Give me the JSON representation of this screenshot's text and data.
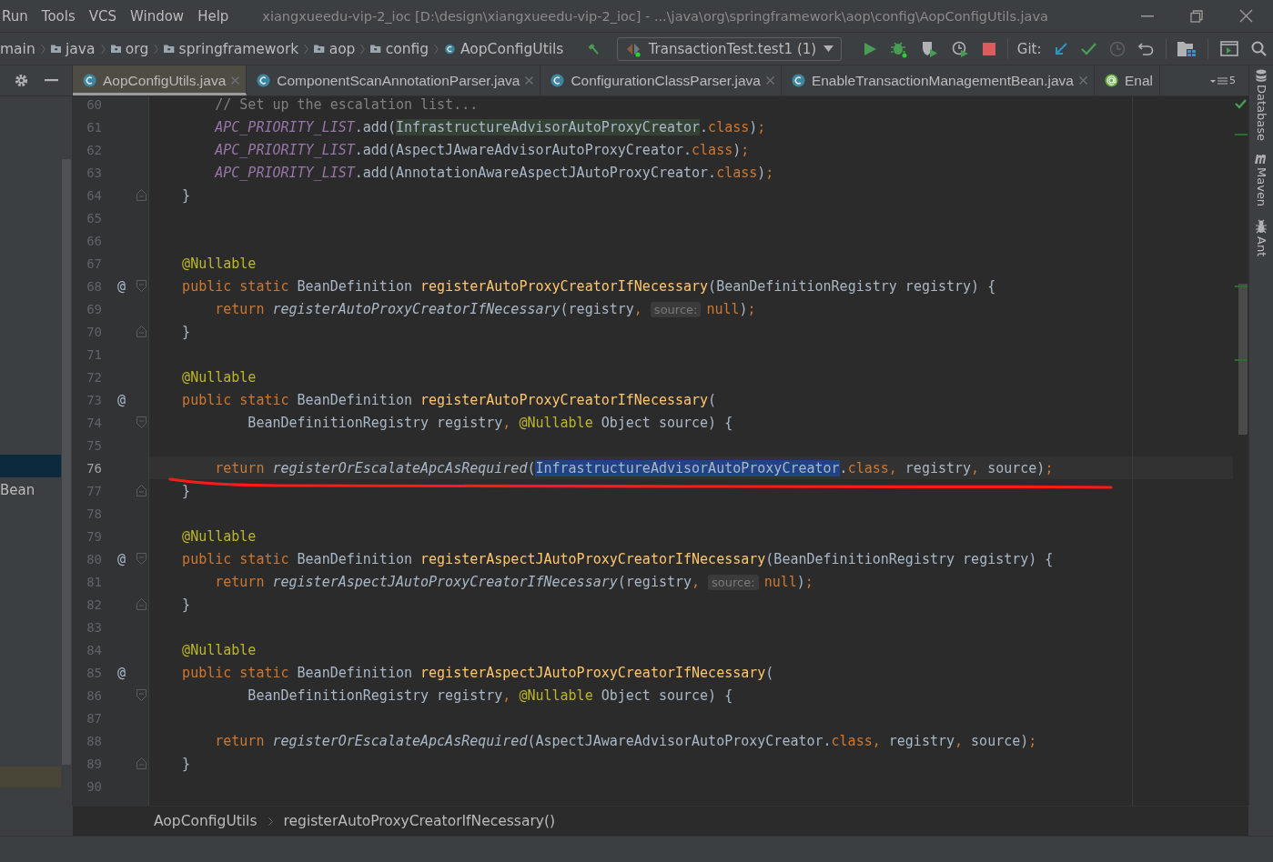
{
  "menu": [
    {
      "label": "Run"
    },
    {
      "label": "Tools"
    },
    {
      "label": "VCS"
    },
    {
      "label": "Window"
    },
    {
      "label": "Help"
    }
  ],
  "window": {
    "title": "xiangxueedu-vip-2_ioc [D:\\design\\xiangxueedu-vip-2_ioc] - ...\\java\\org\\springframework\\aop\\config\\AopConfigUtils.java"
  },
  "navigation": [
    {
      "label": "main",
      "kind": "text"
    },
    {
      "label": "java",
      "kind": "folder"
    },
    {
      "label": "org",
      "kind": "folder"
    },
    {
      "label": "springframework",
      "kind": "folder"
    },
    {
      "label": "aop",
      "kind": "folder"
    },
    {
      "label": "config",
      "kind": "folder"
    },
    {
      "label": "AopConfigUtils",
      "kind": "class"
    }
  ],
  "run_config": {
    "label": "TransactionTest.test1 (1)"
  },
  "git_label": "Git:",
  "tabs": [
    {
      "label": "AopConfigUtils.java",
      "kind": "class",
      "selected": true,
      "closable": true
    },
    {
      "label": "ComponentScanAnnotationParser.java",
      "kind": "class",
      "selected": false,
      "closable": true
    },
    {
      "label": "ConfigurationClassParser.java",
      "kind": "class",
      "selected": false,
      "closable": true
    },
    {
      "label": "EnableTransactionManagementBean.java",
      "kind": "class",
      "selected": false,
      "closable": true
    },
    {
      "label": "Enal",
      "kind": "annotation",
      "selected": false,
      "closable": false
    }
  ],
  "tab_count": "5",
  "project_panel": {
    "items": [
      {
        "label": "Bean"
      }
    ]
  },
  "tool_windows": [
    {
      "label": "Database",
      "kind": "database"
    },
    {
      "label": "Maven",
      "kind": "maven"
    },
    {
      "label": "Ant",
      "kind": "ant"
    }
  ],
  "code": {
    "lines": [
      {
        "number": "60",
        "current": false,
        "tokens": [
          {
            "text": "        // Set up the escalation list...",
            "kind": "comment"
          }
        ]
      },
      {
        "number": "61",
        "current": false,
        "tokens": [
          {
            "text": "        APC_PRIORITY_LIST",
            "kind": "constant"
          },
          {
            "text": ".add(",
            "kind": "plain"
          },
          {
            "text": "InfrastructureAdvisorAutoProxyCreator",
            "kind": "usage"
          },
          {
            "text": ".",
            "kind": "plain"
          },
          {
            "text": "class",
            "kind": "keyword"
          },
          {
            "text": ")",
            "kind": "plain"
          },
          {
            "text": ";",
            "kind": "keyword"
          }
        ]
      },
      {
        "number": "62",
        "current": false,
        "tokens": [
          {
            "text": "        APC_PRIORITY_LIST",
            "kind": "constant"
          },
          {
            "text": ".add(AspectJAwareAdvisorAutoProxyCreator.",
            "kind": "plain"
          },
          {
            "text": "class",
            "kind": "keyword"
          },
          {
            "text": ")",
            "kind": "plain"
          },
          {
            "text": ";",
            "kind": "keyword"
          }
        ]
      },
      {
        "number": "63",
        "current": false,
        "tokens": [
          {
            "text": "        APC_PRIORITY_LIST",
            "kind": "constant"
          },
          {
            "text": ".add(AnnotationAwareAspectJAutoProxyCreator.",
            "kind": "plain"
          },
          {
            "text": "class",
            "kind": "keyword"
          },
          {
            "text": ")",
            "kind": "plain"
          },
          {
            "text": ";",
            "kind": "keyword"
          }
        ]
      },
      {
        "number": "64",
        "current": false,
        "fold": {
          "kind": "end"
        },
        "tokens": [
          {
            "text": "    }",
            "kind": "plain"
          }
        ]
      },
      {
        "number": "65",
        "current": false
      },
      {
        "number": "66",
        "current": false
      },
      {
        "number": "67",
        "current": false,
        "tokens": [
          {
            "text": "    @Nullable",
            "kind": "annotation"
          }
        ]
      },
      {
        "number": "68",
        "current": false,
        "marker": "@",
        "fold": {
          "kind": "start"
        },
        "tokens": [
          {
            "text": "    public static",
            "kind": "keyword"
          },
          {
            "text": " BeanDefinition ",
            "kind": "plain"
          },
          {
            "text": "registerAutoProxyCreatorIfNecessary",
            "kind": "declaration"
          },
          {
            "text": "(BeanDefinitionRegistry registry) {",
            "kind": "plain"
          }
        ]
      },
      {
        "number": "69",
        "current": false,
        "tokens": [
          {
            "text": "        return",
            "kind": "keyword"
          },
          {
            "text": " registerAutoProxyCreatorIfNecessary",
            "kind": "call"
          },
          {
            "text": "(registry",
            "kind": "plain"
          },
          {
            "text": ",",
            "kind": "keyword"
          },
          {
            "text": "source:",
            "kind": "hint"
          },
          {
            "text": "null",
            "kind": "keyword"
          },
          {
            "text": ")",
            "kind": "plain"
          },
          {
            "text": ";",
            "kind": "keyword"
          }
        ]
      },
      {
        "number": "70",
        "current": false,
        "fold": {
          "kind": "end"
        },
        "tokens": [
          {
            "text": "    }",
            "kind": "plain"
          }
        ]
      },
      {
        "number": "71",
        "current": false
      },
      {
        "number": "72",
        "current": false,
        "tokens": [
          {
            "text": "    @Nullable",
            "kind": "annotation"
          }
        ]
      },
      {
        "number": "73",
        "current": false,
        "marker": "@",
        "tokens": [
          {
            "text": "    public static",
            "kind": "keyword"
          },
          {
            "text": " BeanDefinition ",
            "kind": "plain"
          },
          {
            "text": "registerAutoProxyCreatorIfNecessary",
            "kind": "declaration"
          },
          {
            "text": "(",
            "kind": "plain"
          }
        ]
      },
      {
        "number": "74",
        "current": false,
        "fold": {
          "kind": "start"
        },
        "tokens": [
          {
            "text": "            BeanDefinitionRegistry registry",
            "kind": "plain"
          },
          {
            "text": ", ",
            "kind": "keyword"
          },
          {
            "text": "@Nullable",
            "kind": "annotation"
          },
          {
            "text": " Object source) {",
            "kind": "plain"
          }
        ]
      },
      {
        "number": "75",
        "current": false
      },
      {
        "number": "76",
        "current": true,
        "tokens": [
          {
            "text": "        return",
            "kind": "keyword"
          },
          {
            "text": " registerOrEscalateApcAsRequired",
            "kind": "call"
          },
          {
            "text": "(",
            "kind": "plain"
          },
          {
            "text": "InfrastructureAdvisorAutoProxyCreator",
            "kind": "selection"
          },
          {
            "text": ".",
            "kind": "plain"
          },
          {
            "text": "class",
            "kind": "keyword"
          },
          {
            "text": ", ",
            "kind": "keyword"
          },
          {
            "text": "registry",
            "kind": "plain"
          },
          {
            "text": ", ",
            "kind": "keyword"
          },
          {
            "text": "source)",
            "kind": "plain"
          },
          {
            "text": ";",
            "kind": "keyword"
          }
        ]
      },
      {
        "number": "77",
        "current": false,
        "fold": {
          "kind": "end"
        },
        "tokens": [
          {
            "text": "    }",
            "kind": "plain"
          }
        ]
      },
      {
        "number": "78",
        "current": false
      },
      {
        "number": "79",
        "current": false,
        "tokens": [
          {
            "text": "    @Nullable",
            "kind": "annotation"
          }
        ]
      },
      {
        "number": "80",
        "current": false,
        "marker": "@",
        "fold": {
          "kind": "start"
        },
        "tokens": [
          {
            "text": "    public static",
            "kind": "keyword"
          },
          {
            "text": " BeanDefinition ",
            "kind": "plain"
          },
          {
            "text": "registerAspectJAutoProxyCreatorIfNecessary",
            "kind": "declaration"
          },
          {
            "text": "(BeanDefinitionRegistry registry) {",
            "kind": "plain"
          }
        ]
      },
      {
        "number": "81",
        "current": false,
        "tokens": [
          {
            "text": "        return",
            "kind": "keyword"
          },
          {
            "text": " registerAspectJAutoProxyCreatorIfNecessary",
            "kind": "call"
          },
          {
            "text": "(registry",
            "kind": "plain"
          },
          {
            "text": ",",
            "kind": "keyword"
          },
          {
            "text": "source:",
            "kind": "hint"
          },
          {
            "text": "null",
            "kind": "keyword"
          },
          {
            "text": ")",
            "kind": "plain"
          },
          {
            "text": ";",
            "kind": "keyword"
          }
        ]
      },
      {
        "number": "82",
        "current": false,
        "fold": {
          "kind": "end"
        },
        "tokens": [
          {
            "text": "    }",
            "kind": "plain"
          }
        ]
      },
      {
        "number": "83",
        "current": false
      },
      {
        "number": "84",
        "current": false,
        "tokens": [
          {
            "text": "    @Nullable",
            "kind": "annotation"
          }
        ]
      },
      {
        "number": "85",
        "current": false,
        "marker": "@",
        "tokens": [
          {
            "text": "    public static",
            "kind": "keyword"
          },
          {
            "text": " BeanDefinition ",
            "kind": "plain"
          },
          {
            "text": "registerAspectJAutoProxyCreatorIfNecessary",
            "kind": "declaration"
          },
          {
            "text": "(",
            "kind": "plain"
          }
        ]
      },
      {
        "number": "86",
        "current": false,
        "fold": {
          "kind": "start"
        },
        "tokens": [
          {
            "text": "            BeanDefinitionRegistry registry",
            "kind": "plain"
          },
          {
            "text": ", ",
            "kind": "keyword"
          },
          {
            "text": "@Nullable",
            "kind": "annotation"
          },
          {
            "text": " Object source) {",
            "kind": "plain"
          }
        ]
      },
      {
        "number": "87",
        "current": false
      },
      {
        "number": "88",
        "current": false,
        "tokens": [
          {
            "text": "        return",
            "kind": "keyword"
          },
          {
            "text": " registerOrEscalateApcAsRequired",
            "kind": "call"
          },
          {
            "text": "(AspectJAwareAdvisorAutoProxyCreator.",
            "kind": "plain"
          },
          {
            "text": "class",
            "kind": "keyword"
          },
          {
            "text": ", ",
            "kind": "keyword"
          },
          {
            "text": "registry",
            "kind": "plain"
          },
          {
            "text": ", ",
            "kind": "keyword"
          },
          {
            "text": "source)",
            "kind": "plain"
          },
          {
            "text": ";",
            "kind": "keyword"
          }
        ]
      },
      {
        "number": "89",
        "current": false,
        "fold": {
          "kind": "end"
        },
        "tokens": [
          {
            "text": "    }",
            "kind": "plain"
          }
        ]
      },
      {
        "number": "90",
        "current": false
      }
    ]
  },
  "breadcrumbs": [
    {
      "label": "AopConfigUtils"
    },
    {
      "label": "registerAutoProxyCreatorIfNecessary()"
    }
  ]
}
